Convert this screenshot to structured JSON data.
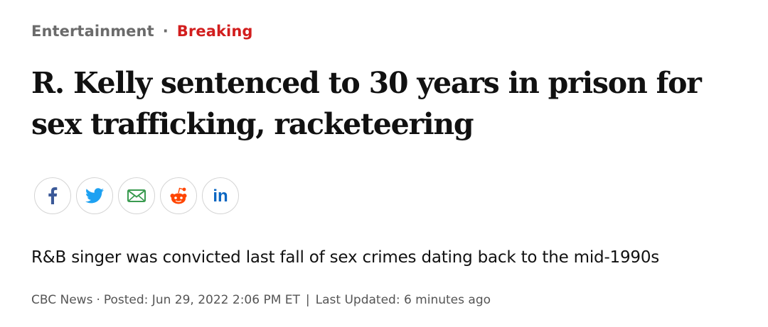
{
  "kicker": {
    "section": "Entertainment",
    "separator": "·",
    "flag": "Breaking"
  },
  "headline": "R. Kelly sentenced to 30 years in prison for sex trafficking, racketeering",
  "share": {
    "buttons": [
      {
        "name": "facebook",
        "icon": "facebook-icon",
        "color": "#3b5998"
      },
      {
        "name": "twitter",
        "icon": "twitter-icon",
        "color": "#1da1f2"
      },
      {
        "name": "email",
        "icon": "email-icon",
        "color": "#3a9b50"
      },
      {
        "name": "reddit",
        "icon": "reddit-icon",
        "color": "#ff4500"
      },
      {
        "name": "linkedin",
        "icon": "linkedin-icon",
        "color": "#0a66c2",
        "label": "in"
      }
    ]
  },
  "deck": "R&B singer was convicted last fall of sex crimes dating back to the mid-1990s",
  "byline": {
    "source": "CBC News",
    "dot": "·",
    "posted": "Posted: Jun 29, 2022 2:06 PM ET",
    "pipe": "|",
    "updated": "Last Updated: 6 minutes ago"
  },
  "colors": {
    "flag": "#d21e1e",
    "section": "#6b6b6b",
    "byline": "#555555"
  }
}
